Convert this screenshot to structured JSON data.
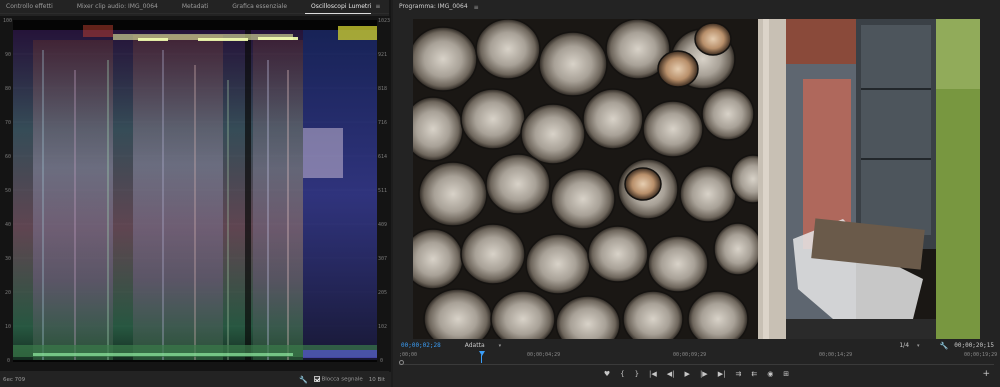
{
  "left": {
    "tabs": [
      {
        "label": "Controllo effetti",
        "active": false
      },
      {
        "label": "Mixer clip audio: IMG_0064",
        "active": false
      },
      {
        "label": "Metadati",
        "active": false
      },
      {
        "label": "Grafica essenziale",
        "active": false
      },
      {
        "label": "Oscilloscopi Lumetri",
        "active": true
      }
    ],
    "tab_menu_glyph": "≡",
    "scope": {
      "left_scale": [
        "100",
        "90",
        "80",
        "70",
        "60",
        "50",
        "40",
        "30",
        "20",
        "10",
        "0"
      ],
      "right_scale": [
        "1023",
        "921",
        "818",
        "716",
        "614",
        "511",
        "409",
        "307",
        "205",
        "102",
        "0"
      ]
    },
    "footer": {
      "record_label": "6ec 709",
      "clamp_label": "Blocca segnale",
      "bit_label": "10 Bit"
    }
  },
  "right": {
    "title": "Programma: IMG_0064",
    "menu_glyph": "≡",
    "current_timecode": "00;00;02;28",
    "fit_label": "Adatta",
    "zoom_label": "1/4",
    "total_timecode": "00;00;20;15",
    "ruler": [
      ";00;00",
      "00;00;04;29",
      "00;00;09;29",
      "00;00;14;29",
      "00;00;19;29"
    ],
    "transport": [
      "♥",
      "{",
      "}",
      "|◀",
      "◀|",
      "▶",
      "|▶",
      "▶|",
      "⇉",
      "⇇",
      "◉",
      "⊞"
    ],
    "add_glyph": "+"
  },
  "colors": {
    "timecode_blue": "#3b9ef7",
    "panel_bg": "#232323",
    "scope_bg": "#050505"
  }
}
